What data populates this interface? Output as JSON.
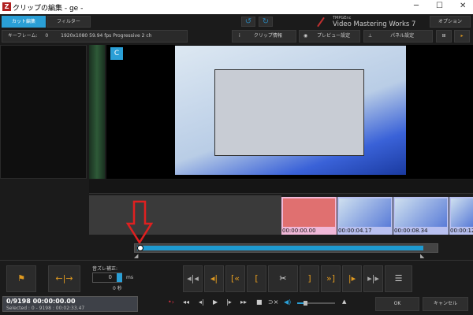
{
  "window": {
    "title": "クリップの編集 - ge -",
    "minimize": "─",
    "maximize": "☐",
    "close": "✕"
  },
  "toolbar": {
    "tabs": [
      {
        "label": "カット編集",
        "active": true
      },
      {
        "label": "フィルター",
        "active": false
      }
    ],
    "undo_icon": "undo-icon",
    "redo_icon": "redo-icon",
    "brand_small": "TMPGEnc",
    "brand": "Video Mastering Works 7",
    "options_label": "オプション"
  },
  "infobar": {
    "keyframe_label": "キーフレーム:",
    "keyframe_value": "0",
    "stream_info": "1920x1080 59.94 fps Progressive 2 ch",
    "clip_info": "クリップ情報",
    "preview_settings": "プレビュー設定",
    "panel_settings": "パネル設定"
  },
  "thumbnails": [
    {
      "time": "00:00:00.00"
    },
    {
      "time": "00:00:04.17"
    },
    {
      "time": "00:00:08.34"
    },
    {
      "time": "00:00:12"
    }
  ],
  "audio_offset": {
    "label": "音ズレ補正:",
    "value": "0",
    "unit": "ms",
    "seconds": "0 秒"
  },
  "status": {
    "frame": "0/9198",
    "time": "00:00:00.00",
    "selected": "Selected : 0 - 9198 : 00:02:33.47"
  },
  "playback_position": 0,
  "volume": 0.2,
  "footer": {
    "ok": "OK",
    "cancel": "キャンセル"
  },
  "colors": {
    "accent": "#2a9fd6",
    "orange": "#e09a20",
    "arrow": "#e02020"
  }
}
